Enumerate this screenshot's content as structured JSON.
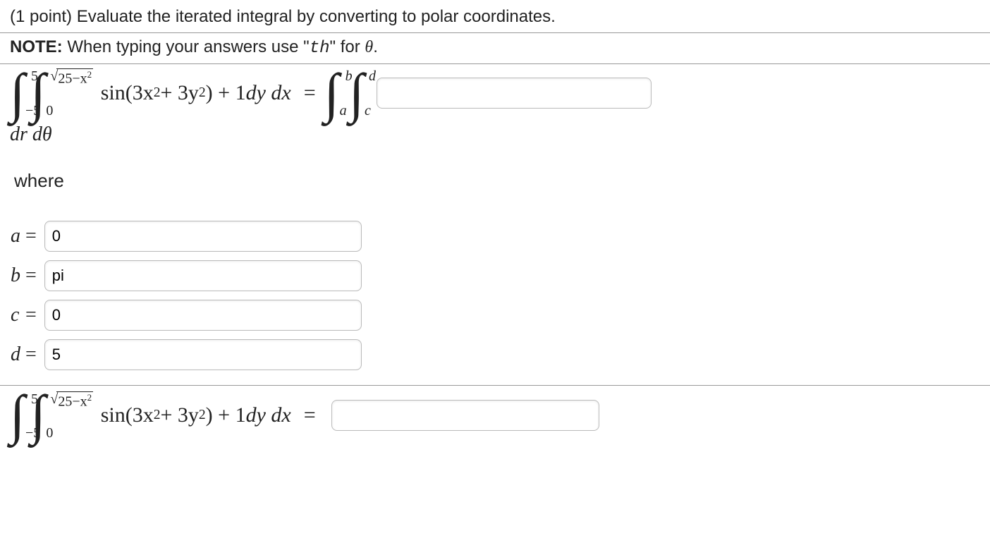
{
  "header": {
    "points": "(1 point)",
    "prompt": "Evaluate the iterated integral by converting to polar coordinates."
  },
  "note": {
    "label": "NOTE:",
    "before": "When typing your answers use \"",
    "code": "th",
    "after": "\" for ",
    "symbol": "θ",
    "period": "."
  },
  "integral1": {
    "outer_lower": "−5",
    "outer_upper": "5",
    "inner_lower": "0",
    "inner_upper_radicand": "25−x",
    "expression_part1": "sin(3x",
    "expression_part2": " + 3y",
    "expression_part3": ") + 1 ",
    "dy": "dy",
    "dx": "dx",
    "eq": "=",
    "polar_outer_lower": "a",
    "polar_outer_upper": "b",
    "polar_inner_lower": "c",
    "polar_inner_upper": "d",
    "dr_dtheta": "dr dθ"
  },
  "where_label": "where",
  "bounds": {
    "a_label": "a",
    "a_value": "0",
    "b_label": "b",
    "b_value": "pi",
    "c_label": "c",
    "c_value": "0",
    "d_label": "d",
    "d_value": "5",
    "eq": "="
  },
  "integral2": {
    "outer_lower": "−5",
    "outer_upper": "5",
    "inner_lower": "0",
    "inner_upper_radicand": "25−x",
    "expression_part1": "sin(3x",
    "expression_part2": " + 3y",
    "expression_part3": ") + 1 ",
    "dy": "dy",
    "dx": "dx",
    "eq": "="
  },
  "inputs": {
    "integrand_value": "",
    "final_value": ""
  }
}
